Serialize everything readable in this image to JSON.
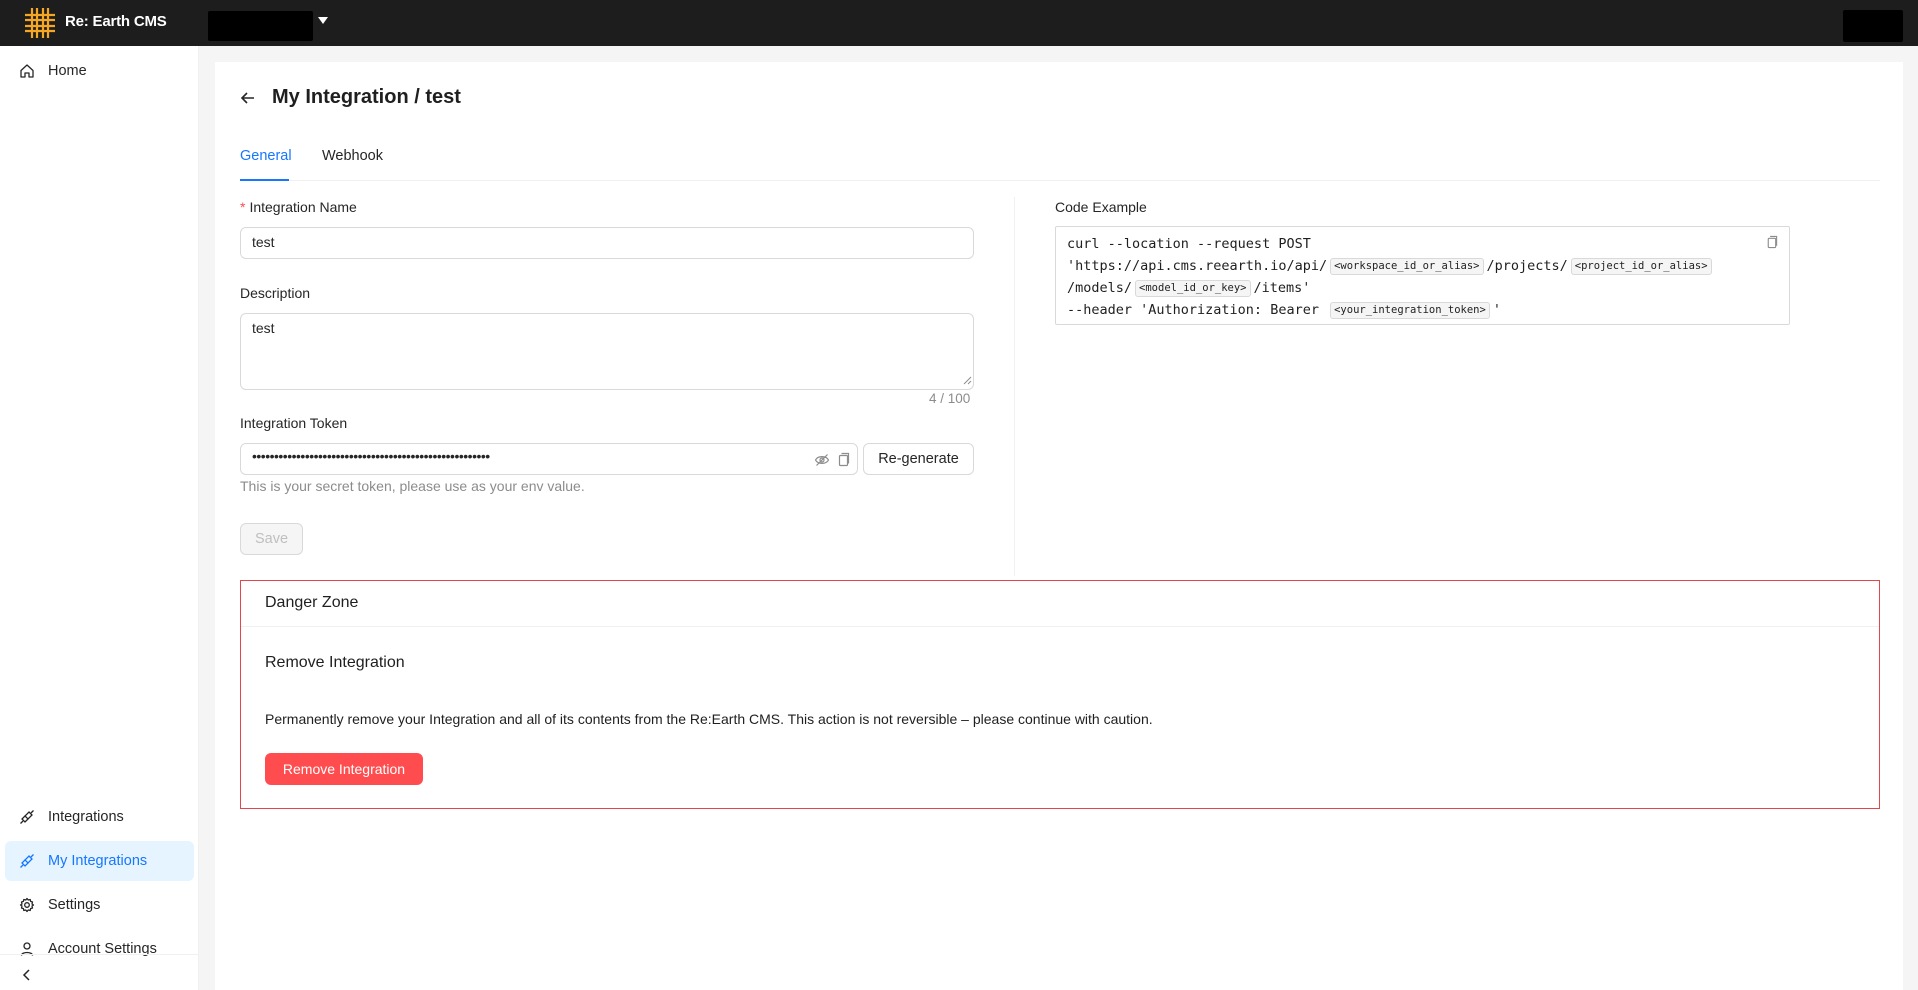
{
  "app": {
    "name": "Re: Earth CMS"
  },
  "sidebar": {
    "items": [
      {
        "label": "Home",
        "icon": "home-icon"
      },
      {
        "label": "Integrations",
        "icon": "api-icon"
      },
      {
        "label": "My Integrations",
        "icon": "api-icon",
        "active": true
      },
      {
        "label": "Settings",
        "icon": "gear-icon"
      },
      {
        "label": "Account Settings",
        "icon": "user-icon"
      }
    ]
  },
  "page": {
    "title": "My Integration / test"
  },
  "tabs": [
    {
      "label": "General",
      "active": true
    },
    {
      "label": "Webhook"
    }
  ],
  "form": {
    "name_label": "Integration Name",
    "name_required_mark": "*",
    "name_value": "test",
    "description_label": "Description",
    "description_value": "test",
    "description_counter": "4 / 100",
    "token_label": "Integration Token",
    "token_masked": "••••••••••••••••••••••••••••••••••••••••••••••••••••••",
    "token_help": "This is your secret token, please use as your env value.",
    "regenerate_label": "Re-generate",
    "save_label": "Save"
  },
  "code_example": {
    "label": "Code Example",
    "line1": "curl --location --request POST",
    "line2_a": "'https://api.cms.reearth.io/api/",
    "tag_workspace": "<workspace_id_or_alias>",
    "line2_b": "/projects/",
    "tag_project": "<project_id_or_alias>",
    "line3_a": "/models/",
    "tag_model": "<model_id_or_key>",
    "line3_b": "/items'",
    "line4_a": "--header 'Authorization: Bearer",
    "tag_token": "<your_integration_token>",
    "line4_b": "'"
  },
  "danger_zone": {
    "title": "Danger Zone",
    "subtitle": "Remove Integration",
    "text": "Permanently remove your Integration and all of its contents from the Re:Earth CMS. This action is not reversible – please continue with caution.",
    "button_label": "Remove Integration"
  },
  "colors": {
    "accent": "#1677ff",
    "danger": "#ff4d4f",
    "header_bg": "#1d1d1d",
    "logo": "#f5a623"
  }
}
